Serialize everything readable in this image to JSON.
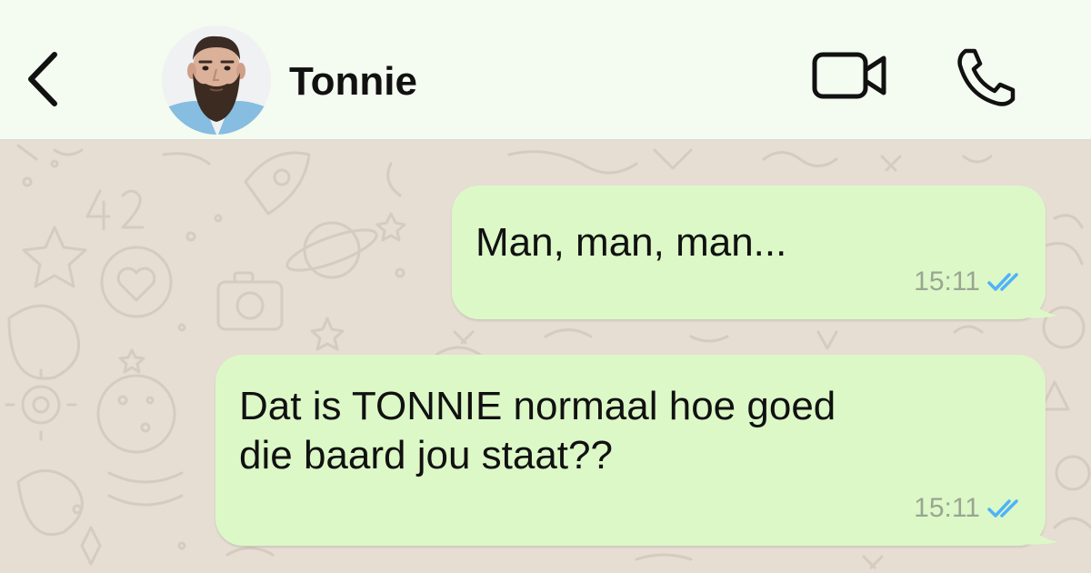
{
  "header": {
    "contact_name": "Tonnie",
    "back_icon": "chevron-left-icon",
    "video_icon": "video-camera-icon",
    "call_icon": "phone-icon"
  },
  "messages": [
    {
      "direction": "outgoing",
      "text": "Man, man, man...",
      "time": "15:11",
      "status": "read"
    },
    {
      "direction": "outgoing",
      "text_lines": [
        "Dat is TONNIE normaal hoe goed",
        "die baard jou staat??"
      ],
      "time": "15:11",
      "status": "read"
    }
  ],
  "colors": {
    "header_bg": "#f4fbf1",
    "chat_bg": "#e6ddd3",
    "bubble_out": "#dcf8c7",
    "read_ticks": "#4fb3f6",
    "timestamp": "#9aa593"
  }
}
